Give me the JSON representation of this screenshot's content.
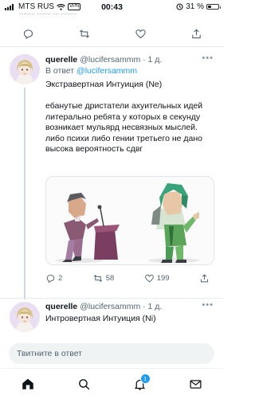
{
  "status_bar": {
    "carrier": "MTS RUS",
    "vpn": "VPN",
    "time": "00:43",
    "battery": "31 %",
    "battery_level": 0.31
  },
  "previous_tweet": {
    "cut_text": "........ ....... ... ........"
  },
  "tweets": [
    {
      "name": "querelle",
      "handle": "@lucifersammm",
      "time": "· 1 д.",
      "reply_prefix": "В ответ",
      "reply_handle": "@lucifersammm",
      "text": "Экстравертная Интуиция (Ne)\n\nебанутые дристатели ахуительных идей литерально ребята у которых в секунду возникает мульярд несвязных мыслей. либо психи либо гении третьего не дано\nвысока вероятность сдвг",
      "replies": "2",
      "retweets": "58",
      "likes": "199"
    },
    {
      "name": "querelle",
      "handle": "@lucifersammm",
      "time": "· 1 д.",
      "text": "Интровертная Интуиция (Ni)"
    }
  ],
  "composer": {
    "placeholder": "Твитните в ответ"
  },
  "tabbar": {
    "notifications_badge": "1"
  },
  "colors": {
    "accent": "#1d9bf0",
    "text": "#0f1419",
    "muted": "#536471",
    "retweet": "#00ba7c"
  }
}
